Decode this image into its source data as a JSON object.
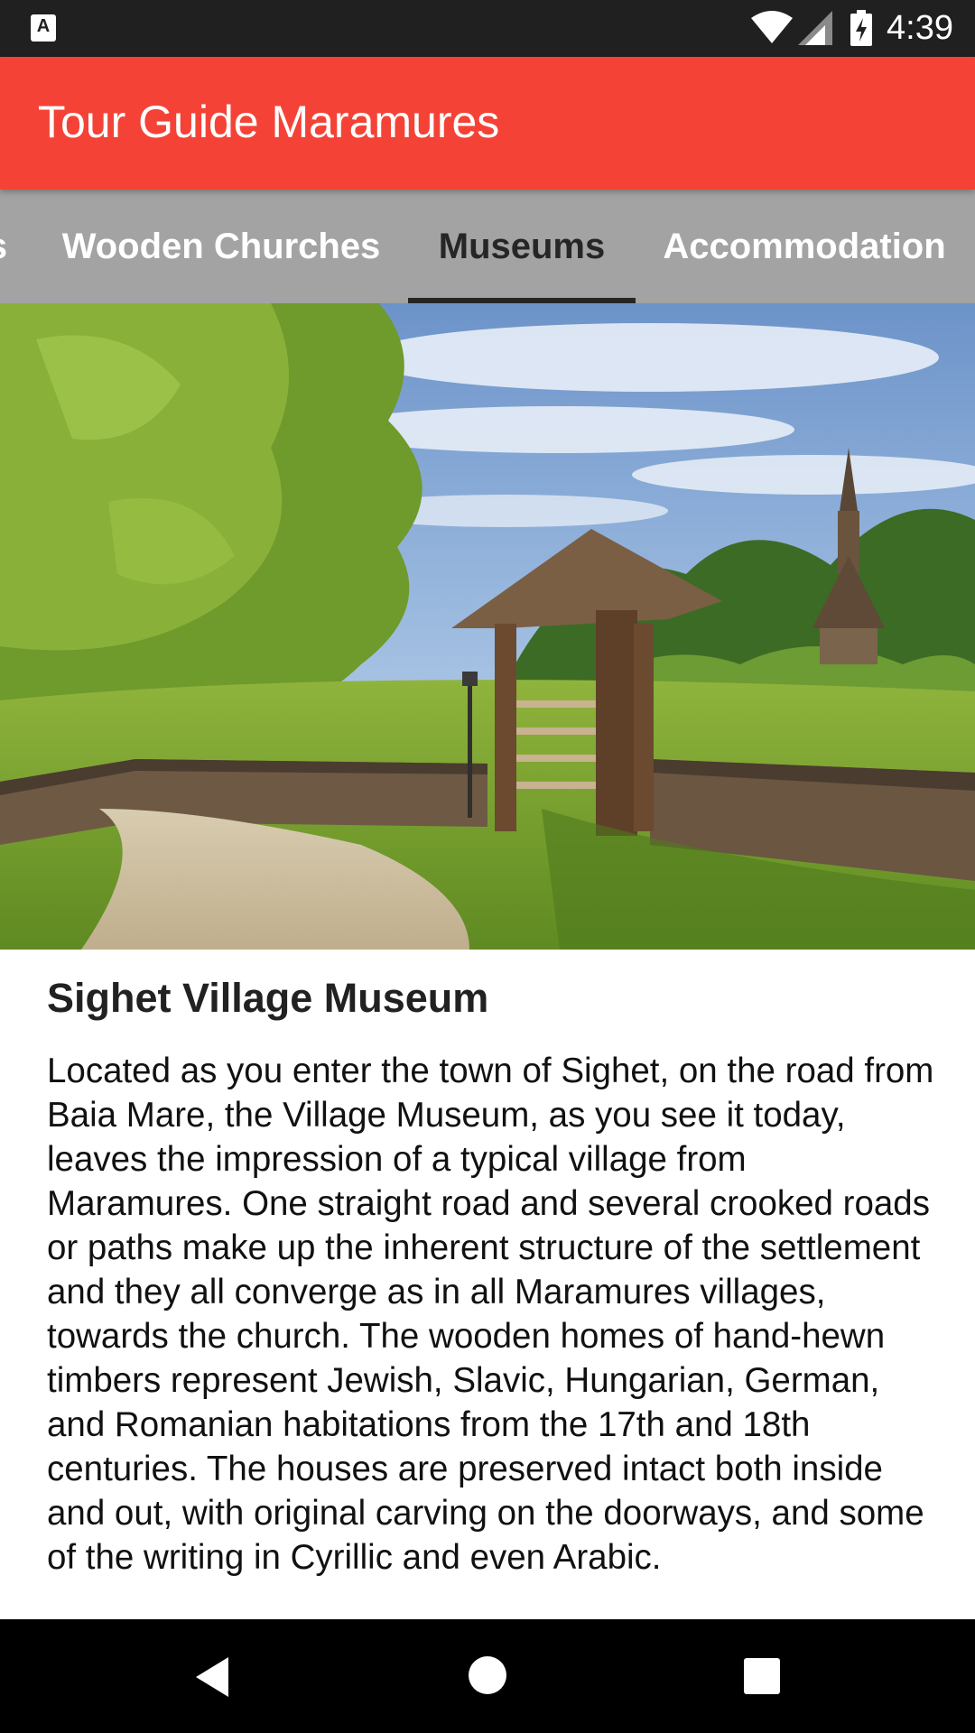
{
  "status_bar": {
    "notification_icon": "a-badge-icon",
    "notification_glyph": "A",
    "icons": [
      "wifi-icon",
      "signal-icon",
      "battery-charging-icon"
    ],
    "time": "4:39"
  },
  "app_bar": {
    "title": "Tour Guide Maramures",
    "color": "#f44336"
  },
  "tabs": {
    "items": [
      {
        "label": "s"
      },
      {
        "label": "Wooden Churches"
      },
      {
        "label": "Museums",
        "selected": true
      },
      {
        "label": "Accommodation"
      }
    ],
    "background": "#a3a3a3"
  },
  "content": {
    "title": "Sighet Village Museum",
    "body": "Located as you enter the town of Sighet, on the road from Baia Mare, the Village Museum, as you see it today, leaves the impression of a typical village from Maramures. One straight road and several crooked roads or paths make up the inherent structure of the settlement and they all converge as in all Maramures villages, towards the church. The wooden homes of hand-hewn timbers represent Jewish, Slavic, Hungarian, German, and Romanian habitations from the 17th and 18th centuries. The houses are preserved intact both inside and out, with original carving on the doorways, and some of the writing in Cyrillic and even Arabic."
  },
  "nav_bar": {
    "buttons": [
      "back-icon",
      "home-icon",
      "recents-icon"
    ]
  }
}
